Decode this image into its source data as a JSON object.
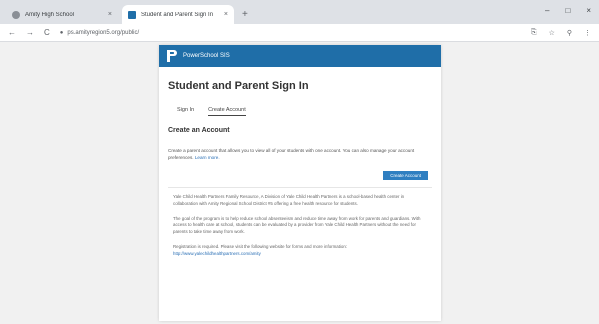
{
  "browser": {
    "tabs": [
      {
        "title": "Amity High School",
        "close": "×"
      },
      {
        "title": "Student and Parent Sign In",
        "close": "×"
      }
    ],
    "new_tab": "+",
    "window_controls": [
      "–",
      "□",
      "×"
    ],
    "url": "ps.amityregion5.org/public/",
    "nav": {
      "back": "←",
      "forward": "→",
      "reload": "C"
    },
    "toolbar_icons": [
      "⎘",
      "☆",
      "⚲",
      "⋮"
    ]
  },
  "brand": {
    "name": "PowerSchool SIS",
    "color": "#1f6ea8"
  },
  "page": {
    "title": "Student and Parent Sign In",
    "tabs": {
      "signin": "Sign In",
      "create": "Create Account"
    },
    "section_title": "Create an Account",
    "lead_text": "Create a parent account that allows you to view all of your students with one account. You can also manage your account preferences.",
    "learn_more": "Learn more.",
    "create_button": "Create Account",
    "paragraphs": [
      "Yale Child Health Partners Family Resource, A Division of Yale Child Health Partners is a school-based health center in collaboration with Amity Regional School District #5 offering a free health resource for students.",
      "The goal of the program is to help reduce school absenteeism and reduce time away from work for parents and guardians. With access to health care at school, students can be evaluated by a provider from Yale Child Health Partners without the need for parents to take time away from work.",
      "Registration is required. Please visit the following website for forms and more information:"
    ],
    "registration_link": "http://www.yalechildhealthpartners.com/amity"
  }
}
